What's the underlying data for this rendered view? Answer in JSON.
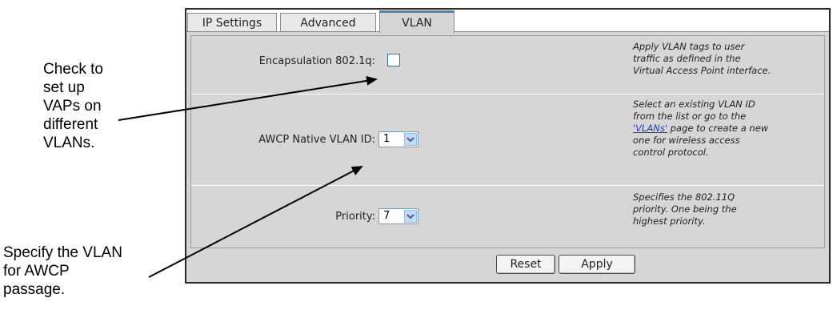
{
  "callouts": {
    "vap": [
      "Check to",
      "set up",
      "VAPs on",
      "different",
      "VLANs."
    ],
    "awcp": [
      "Specify the VLAN",
      "for AWCP",
      "passage."
    ]
  },
  "tabs": [
    {
      "label": "IP Settings",
      "active": false
    },
    {
      "label": "Advanced",
      "active": false
    },
    {
      "label": "VLAN",
      "active": true
    }
  ],
  "settings": {
    "encapsulation": {
      "label": "Encapsulation 802.1q:",
      "checked": false,
      "desc": [
        "Apply VLAN tags to user",
        "traffic as defined in the",
        "Virtual Access Point interface."
      ]
    },
    "native_vlan": {
      "label": "AWCP Native VLAN ID:",
      "value": "1",
      "desc_pre": [
        "Select an existing VLAN ID",
        "from the list or go to the"
      ],
      "desc_link": "'VLANs'",
      "desc_post_same_line": " page to create a new",
      "desc_post": [
        "one for wireless access",
        "control protocol."
      ]
    },
    "priority": {
      "label": "Priority:",
      "value": "7",
      "desc": [
        "Specifies the 802.11Q",
        "priority. One being the",
        "highest priority."
      ]
    }
  },
  "buttons": {
    "reset": "Reset",
    "apply": "Apply"
  },
  "colors": {
    "active_tab_accent": "#3d89bd",
    "panel_bg": "#d6d6d6",
    "link": "#1a3fb8",
    "select_button": "#c6d8f7"
  },
  "icons": {
    "dropdown": "chevron-down-icon",
    "arrow": "arrow-icon"
  }
}
